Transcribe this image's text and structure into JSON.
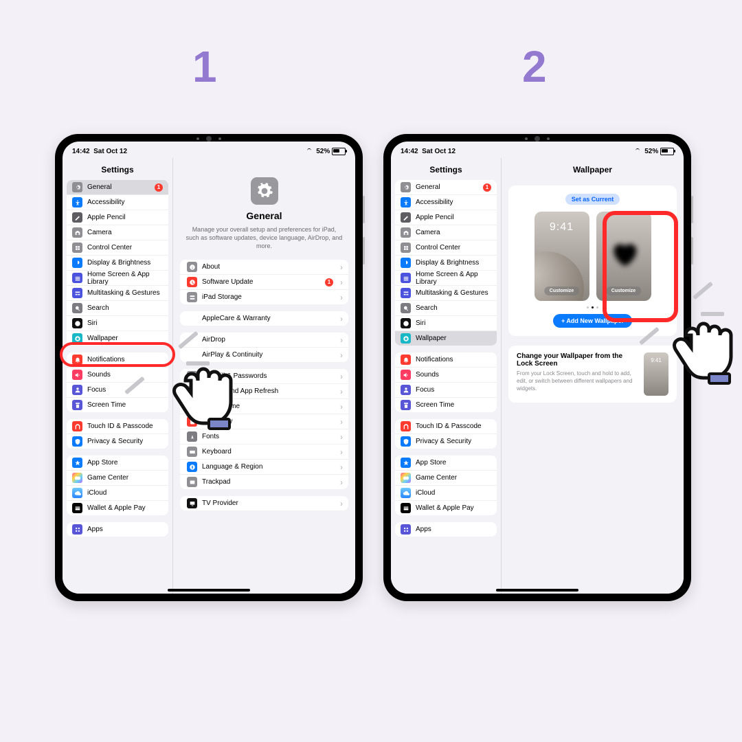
{
  "steps": {
    "s1": "1",
    "s2": "2"
  },
  "status": {
    "time": "14:42",
    "date": "Sat Oct 12",
    "battery": "52%"
  },
  "sidebar": {
    "title": "Settings",
    "groups": [
      {
        "items": [
          {
            "label": "General",
            "icon": "gear",
            "color": "#8e8e93",
            "selected": true,
            "badge": "1"
          },
          {
            "label": "Accessibility",
            "icon": "access",
            "color": "#0a7aff"
          },
          {
            "label": "Apple Pencil",
            "icon": "pencil",
            "color": "#5d5d62"
          },
          {
            "label": "Camera",
            "icon": "camera",
            "color": "#8e8e93"
          },
          {
            "label": "Control Center",
            "icon": "cc",
            "color": "#8e8e93"
          },
          {
            "label": "Display & Brightness",
            "icon": "display",
            "color": "#0a7aff"
          },
          {
            "label": "Home Screen & App Library",
            "icon": "home",
            "color": "#4a52de"
          },
          {
            "label": "Multitasking & Gestures",
            "icon": "mt",
            "color": "#4a52de"
          },
          {
            "label": "Search",
            "icon": "search",
            "color": "#7c7c81"
          },
          {
            "label": "Siri",
            "icon": "siri",
            "color": "#111"
          },
          {
            "label": "Wallpaper",
            "icon": "wall",
            "color": "#19b8c7"
          }
        ]
      },
      {
        "items": [
          {
            "label": "Notifications",
            "icon": "notif",
            "color": "#ff3b30"
          },
          {
            "label": "Sounds",
            "icon": "sound",
            "color": "#ff3b62"
          },
          {
            "label": "Focus",
            "icon": "focus",
            "color": "#5856d6"
          },
          {
            "label": "Screen Time",
            "icon": "st",
            "color": "#5856d6"
          }
        ]
      },
      {
        "items": [
          {
            "label": "Touch ID & Passcode",
            "icon": "touch",
            "color": "#ff3b30"
          },
          {
            "label": "Privacy & Security",
            "icon": "priv",
            "color": "#0a7aff"
          }
        ]
      },
      {
        "items": [
          {
            "label": "App Store",
            "icon": "appst",
            "color": "#0a7aff"
          },
          {
            "label": "Game Center",
            "icon": "gc",
            "color": "#fff",
            "multi": true
          },
          {
            "label": "iCloud",
            "icon": "cloud",
            "color": "#fff"
          },
          {
            "label": "Wallet & Apple Pay",
            "icon": "wallet",
            "color": "#000"
          }
        ]
      },
      {
        "items": [
          {
            "label": "Apps",
            "icon": "apps",
            "color": "#5856d6"
          }
        ]
      }
    ]
  },
  "general": {
    "title": "General",
    "desc": "Manage your overall setup and preferences for iPad, such as software updates, device language, AirDrop, and more.",
    "groups": [
      [
        {
          "label": "About",
          "icon": "about",
          "color": "#8e8e93"
        },
        {
          "label": "Software Update",
          "icon": "upd",
          "color": "#ff3b30",
          "badge": "1"
        },
        {
          "label": "iPad Storage",
          "icon": "stor",
          "color": "#8e8e93"
        }
      ],
      [
        {
          "label": "AppleCare & Warranty",
          "icon": "care",
          "color": "#ff3b30",
          "left": true
        }
      ],
      [
        {
          "label": "AirDrop",
          "icon": "airdrop",
          "color": "#fff"
        },
        {
          "label": "AirPlay & Continuity",
          "icon": "airplay",
          "color": "#fff"
        }
      ],
      [
        {
          "label": "AutoFill & Passwords",
          "icon": "pwd",
          "color": "#8e8e93"
        },
        {
          "label": "Background App Refresh",
          "icon": "bg",
          "color": "#8e8e93"
        },
        {
          "label": "Date & Time",
          "icon": "dt",
          "color": "#0a7aff"
        },
        {
          "label": "Dictionary",
          "icon": "dict",
          "color": "#ff3b30"
        },
        {
          "label": "Fonts",
          "icon": "font",
          "color": "#7c7c81"
        },
        {
          "label": "Keyboard",
          "icon": "kb",
          "color": "#8e8e93"
        },
        {
          "label": "Language & Region",
          "icon": "lang",
          "color": "#0a7aff"
        },
        {
          "label": "Trackpad",
          "icon": "tp",
          "color": "#8e8e93"
        }
      ],
      [
        {
          "label": "TV Provider",
          "icon": "tv",
          "color": "#111"
        }
      ]
    ]
  },
  "wallpaper": {
    "title": "Wallpaper",
    "setCurrent": "Set as Current",
    "clock": "9:41",
    "customize": "Customize",
    "addNew": "+ Add New Wallpaper",
    "infoTitle": "Change your Wallpaper from the Lock Screen",
    "infoDesc": "From your Lock Screen, touch and hold to add, edit, or switch between different wallpapers and widgets.",
    "miniClock": "9:41"
  }
}
